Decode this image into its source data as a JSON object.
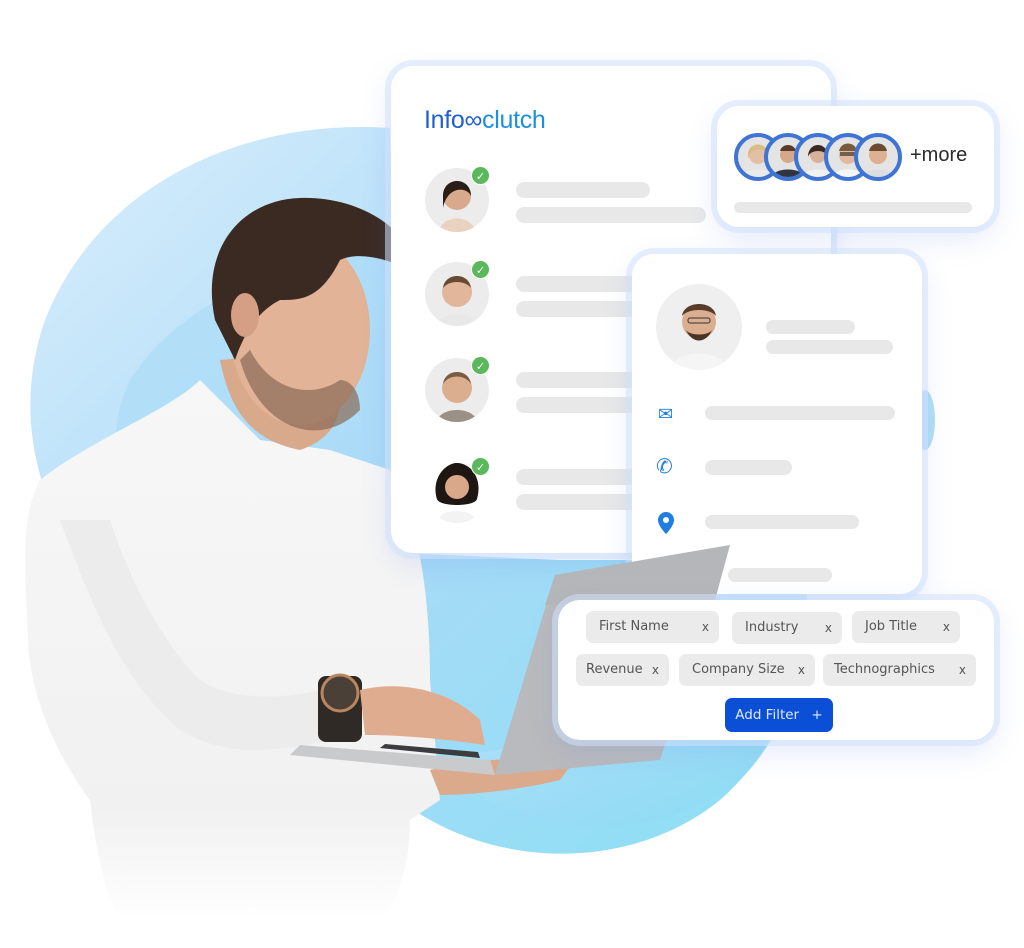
{
  "brand": {
    "logo_text_start": "Info",
    "logo_text_end": "clutch",
    "logo_mark": "∞",
    "primary_color": "#1e5fd2",
    "accent_button_color": "#0a4fd6",
    "verified_color": "#5cb85c"
  },
  "contact_list": {
    "rows": [
      {
        "avatar": "woman-dark-hair-avatar",
        "verified": true,
        "check_glyph": "✓"
      },
      {
        "avatar": "man-short-hair-avatar",
        "verified": true,
        "check_glyph": "✓"
      },
      {
        "avatar": "man-smiling-avatar",
        "verified": true,
        "check_glyph": "✓"
      },
      {
        "avatar": "woman-curly-hair-avatar",
        "verified": true,
        "check_glyph": "✓"
      }
    ]
  },
  "team_card": {
    "avatar_count": 5,
    "more_label": "+more"
  },
  "profile_card": {
    "avatar": "man-glasses-avatar",
    "fields": [
      {
        "icon": "email-icon",
        "glyph": "✉"
      },
      {
        "icon": "phone-icon",
        "glyph": "✆"
      },
      {
        "icon": "location-pin-icon",
        "glyph": "⚲"
      }
    ]
  },
  "filters": {
    "chips": [
      {
        "label": "First Name",
        "remove": "x"
      },
      {
        "label": "Industry",
        "remove": "x"
      },
      {
        "label": "Job Title",
        "remove": "x"
      },
      {
        "label": "Revenue",
        "remove": "x"
      },
      {
        "label": "Company Size",
        "remove": "x"
      },
      {
        "label": "Technographics",
        "remove": "x"
      }
    ],
    "add_button_label": "Add Filter",
    "add_button_icon": "+"
  }
}
